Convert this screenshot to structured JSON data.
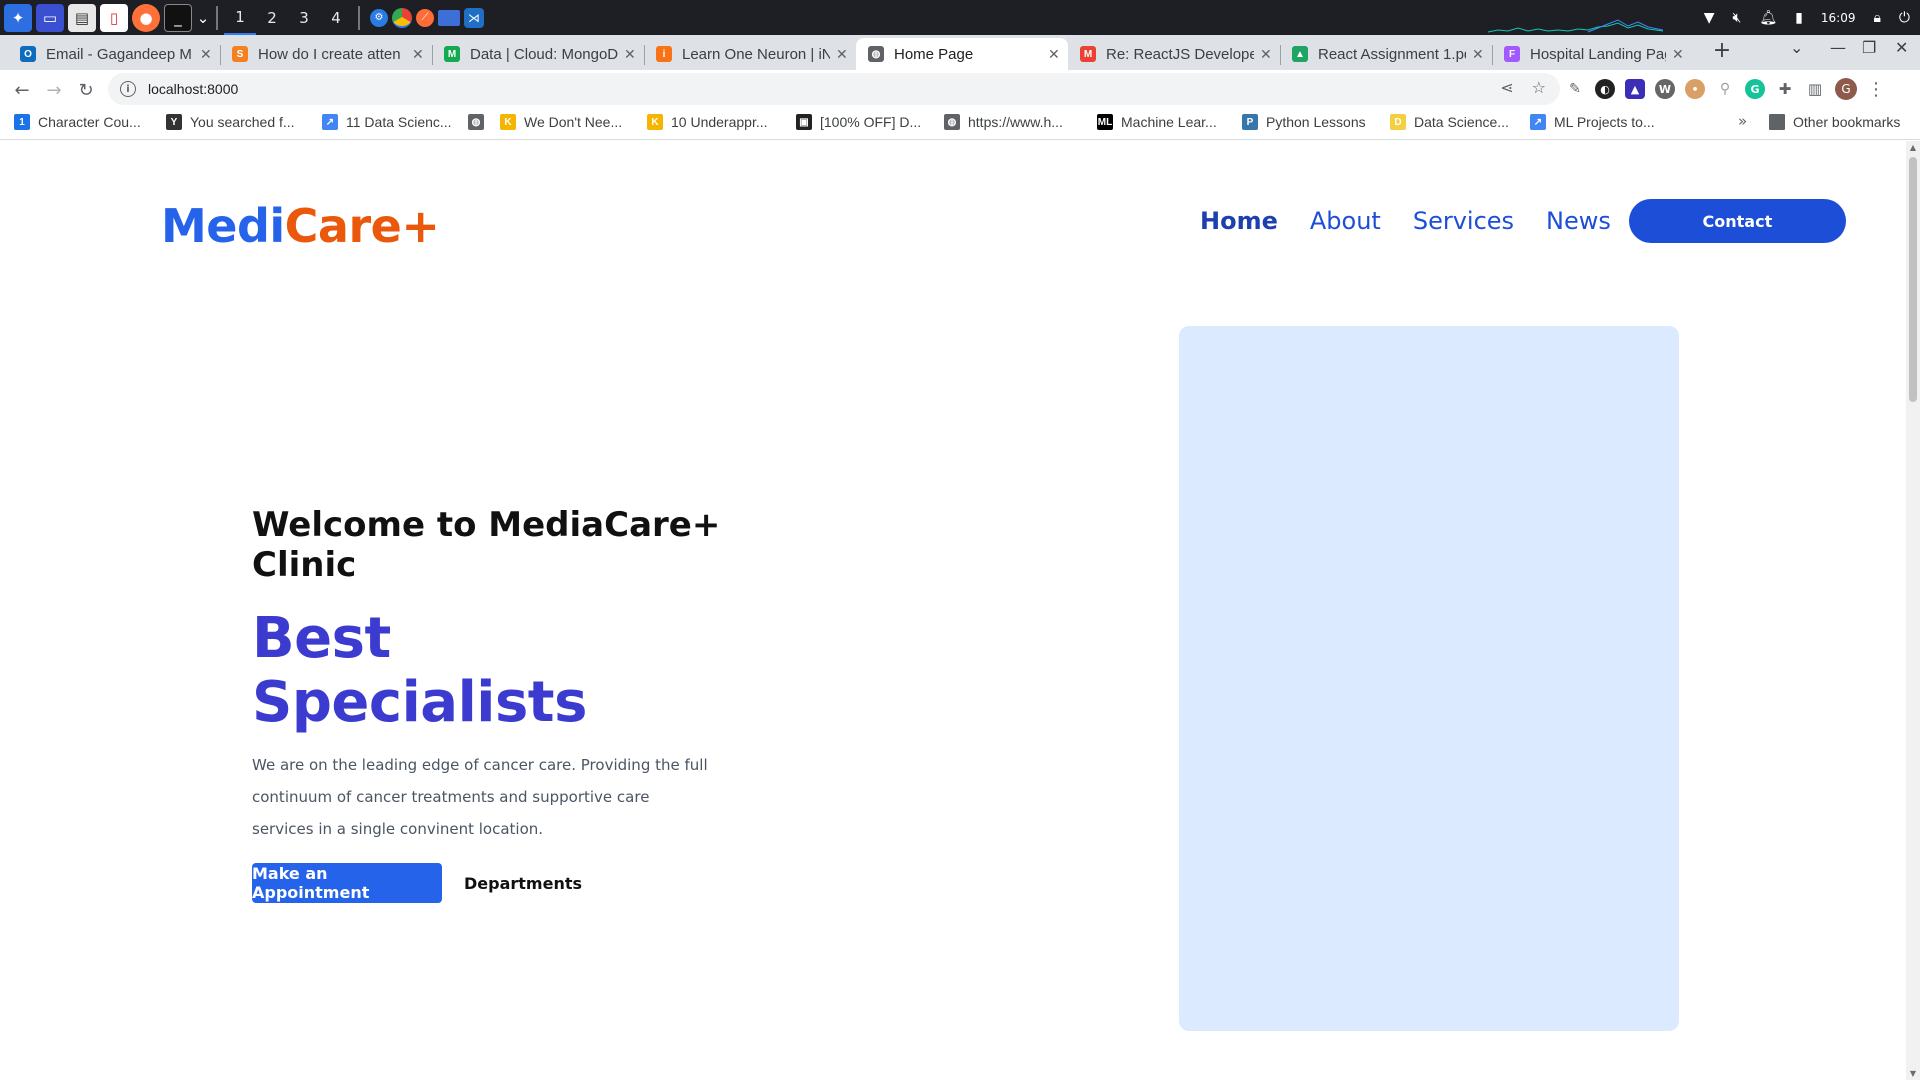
{
  "taskbar": {
    "workspaces": [
      "1",
      "2",
      "3",
      "4"
    ],
    "clock": "16:09"
  },
  "tabs": [
    {
      "title": "Email - Gagandeep M",
      "icon": "outlook-icon",
      "color": "#0f6cbd",
      "glyph": "O"
    },
    {
      "title": "How do I create atten",
      "icon": "stackoverflow-icon",
      "color": "#f48024",
      "glyph": "S"
    },
    {
      "title": "Data | Cloud: MongoD",
      "icon": "mongodb-icon",
      "color": "#13aa52",
      "glyph": "M"
    },
    {
      "title": "Learn One Neuron | iN",
      "icon": "ineuron-icon",
      "color": "#f97316",
      "glyph": "i"
    },
    {
      "title": "Home Page",
      "icon": "globe-icon",
      "color": "#5f6368",
      "glyph": "◍"
    },
    {
      "title": "Re: ReactJS Developer",
      "icon": "gmail-icon",
      "color": "#ea4335",
      "glyph": "M"
    },
    {
      "title": "React Assignment 1.pd",
      "icon": "drive-icon",
      "color": "#1fa463",
      "glyph": "▲"
    },
    {
      "title": "Hospital Landing Pag",
      "icon": "figma-icon",
      "color": "#a259ff",
      "glyph": "F"
    }
  ],
  "address_bar": {
    "url": "localhost:8000"
  },
  "bookmarks": [
    {
      "label": "Character Cou...",
      "icon": "bookmark-charcount-icon",
      "color": "#1a73e8",
      "glyph": "1"
    },
    {
      "label": "You searched f...",
      "icon": "bookmark-search-icon",
      "color": "#333333",
      "glyph": "Y"
    },
    {
      "label": "11 Data Scienc...",
      "icon": "bookmark-chart-icon",
      "color": "#4285f4",
      "glyph": "↗"
    },
    {
      "label": "",
      "icon": "bookmark-globe-icon",
      "color": "#5f6368",
      "glyph": "◍"
    },
    {
      "label": "We Don't Nee...",
      "icon": "bookmark-k-icon",
      "color": "#f4b400",
      "glyph": "K"
    },
    {
      "label": "10 Underappr...",
      "icon": "bookmark-k2-icon",
      "color": "#f4b400",
      "glyph": "K"
    },
    {
      "label": "[100% OFF] D...",
      "icon": "bookmark-offer-icon",
      "color": "#222222",
      "glyph": "▣"
    },
    {
      "label": "https://www.h...",
      "icon": "bookmark-web-icon",
      "color": "#5f6368",
      "glyph": "◍"
    },
    {
      "label": "Machine Lear...",
      "icon": "bookmark-ml-icon",
      "color": "#000000",
      "glyph": "ML"
    },
    {
      "label": "Python Lessons",
      "icon": "bookmark-python-icon",
      "color": "#3776ab",
      "glyph": "P"
    },
    {
      "label": "Data Science...",
      "icon": "bookmark-ds-icon",
      "color": "#f4d03f",
      "glyph": "D"
    },
    {
      "label": "ML Projects to...",
      "icon": "bookmark-mlproj-icon",
      "color": "#4285f4",
      "glyph": "↗"
    }
  ],
  "bookmarks_other": "Other bookmarks",
  "page": {
    "logo": {
      "part1": "Medi",
      "part2": "Care+"
    },
    "nav": {
      "links": [
        "Home",
        "About",
        "Services",
        "News"
      ],
      "contact": "Contact"
    },
    "hero": {
      "welcome": "Welcome to MediaCare+ Clinic",
      "title": "Best Specialists",
      "description": "We are on the leading edge of cancer care. Providing the full continuum of cancer treatments and supportive care services in a single convinent location.",
      "appointment_button": "Make an Appointment",
      "departments_button": "Departments"
    }
  },
  "colors": {
    "brand_blue": "#2563eb",
    "brand_orange": "#ea580c",
    "hero_title": "#3b3bcf",
    "hero_image_placeholder": "#dbeafe"
  }
}
